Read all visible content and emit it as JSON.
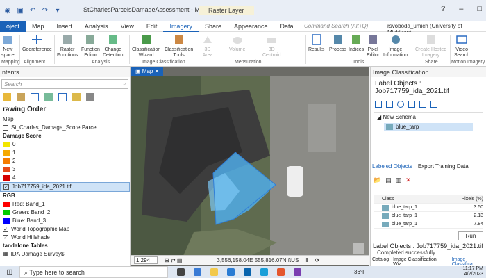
{
  "window": {
    "title": "StCharlesParcelsDamageAssessment - Map - ArcGIS Pro",
    "context_tab": "Raster Layer",
    "controls": [
      "?",
      "–",
      "□"
    ]
  },
  "menu": {
    "tabs": [
      "oject",
      "Map",
      "Insert",
      "Analysis",
      "View",
      "Edit",
      "Imagery",
      "Share",
      "Appearance",
      "Data"
    ],
    "active": "Imagery",
    "command_search": "Command Search (Alt+Q)",
    "user": "rsvoboda_umich (University of Michigan)"
  },
  "ribbon": {
    "buttons": [
      {
        "label": "New\nspace",
        "group": "Mapping"
      },
      {
        "label": "Georeference",
        "group": "Alignment"
      },
      {
        "label": "Raster\nFunctions",
        "group": "Analysis"
      },
      {
        "label": "Function\nEditor",
        "group": "Analysis"
      },
      {
        "label": "Change\nDetection",
        "group": "Analysis"
      },
      {
        "label": "Classification\nWizard",
        "group": "Image Classification"
      },
      {
        "label": "Classification\nTools",
        "group": "Image Classification"
      },
      {
        "label": "3D\nArea",
        "group": "Mensuration"
      },
      {
        "label": "Volume",
        "group": "Mensuration"
      },
      {
        "label": "3D\nCentroid",
        "group": "Mensuration"
      },
      {
        "label": "Results",
        "group": "Tools"
      },
      {
        "label": "Process",
        "group": "Tools"
      },
      {
        "label": "Indices",
        "group": "Tools"
      },
      {
        "label": "Pixel\nEditor",
        "group": "Tools"
      },
      {
        "label": "Image\nInformation",
        "group": "Tools"
      },
      {
        "label": "Create Hosted\nImagery",
        "group": "Share"
      },
      {
        "label": "Video\nSearch",
        "group": "Motion Imagery"
      }
    ],
    "groups": [
      "Mapping",
      "Alignment",
      "Analysis",
      "Image Classification",
      "Mensuration",
      "Tools",
      "Share",
      "Motion Imagery"
    ]
  },
  "contents": {
    "title": "ntents",
    "search_placeholder": "Search",
    "section": "rawing Order",
    "items": [
      {
        "label": "Map"
      },
      {
        "label": "St_Charles_Damage_Score Parcel",
        "checked": false
      },
      {
        "label": "Damage Score",
        "bold": true
      }
    ],
    "damage_scores": [
      {
        "label": "0",
        "color": "#f2e600"
      },
      {
        "label": "1",
        "color": "#f5a800"
      },
      {
        "label": "2",
        "color": "#f57c00"
      },
      {
        "label": "3",
        "color": "#e64a19"
      },
      {
        "label": "4",
        "color": "#d50000"
      }
    ],
    "raster_layer": "Job717759_ida_2021.tif",
    "rgb_label": "RGB",
    "bands": [
      {
        "label": "Red: Band_1",
        "color": "#ff0000"
      },
      {
        "label": "Green: Band_2",
        "color": "#00cc00"
      },
      {
        "label": "Blue: Band_3",
        "color": "#0000ff"
      }
    ],
    "basemaps": [
      "World Topographic Map",
      "World Hillshade"
    ],
    "standalone": "tandalone Tables",
    "table": "IDA Damage Survey$'"
  },
  "map": {
    "tab": "Map",
    "scale": "1:294",
    "coords": "3,556,158.04E 555,816.07N ftUS"
  },
  "image_classification": {
    "title": "Image Classification",
    "subtitle": "Label Objects : Job717759_ida_2021.tif",
    "schema": "New Schema",
    "class": "blue_tarp",
    "tab_labeled": "Labeled Objects",
    "tab_export": "Export Training Data",
    "columns": [
      "Class",
      "Pixels (%)"
    ],
    "rows": [
      {
        "class": "blue_tarp_1",
        "pct": "3.50"
      },
      {
        "class": "blue_tarp_1",
        "pct": "2.13"
      },
      {
        "class": "blue_tarp_1",
        "pct": "7.84"
      }
    ],
    "run": "Run",
    "status_title": "Label Objects : Job717759_ida_2021.tif",
    "status_msg": "Completed successfully",
    "bottom_tabs": [
      "Catalog",
      "Image Classification Wiz...",
      "Image Classifica"
    ]
  },
  "taskbar": {
    "search": "Type here to search",
    "temp": "36°F",
    "time": "11:17 PM",
    "date": "4/2/2023"
  }
}
